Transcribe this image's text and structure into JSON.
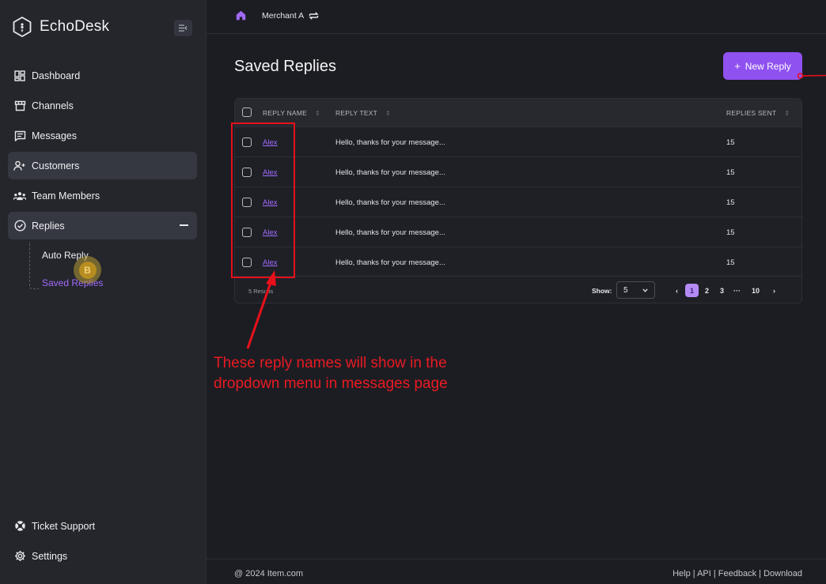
{
  "sidebar": {
    "brand": "EchoDesk",
    "items": [
      {
        "label": "Dashboard",
        "icon": "dashboard-icon"
      },
      {
        "label": "Channels",
        "icon": "store-icon"
      },
      {
        "label": "Messages",
        "icon": "message-icon"
      },
      {
        "label": "Customers",
        "icon": "customers-icon"
      },
      {
        "label": "Team Members",
        "icon": "team-icon"
      },
      {
        "label": "Replies",
        "icon": "check-circle-icon"
      }
    ],
    "sub_items": [
      {
        "label": "Auto Reply"
      },
      {
        "label": "Saved Replies"
      }
    ],
    "bottom_items": [
      {
        "label": "Ticket Support",
        "icon": "lifebuoy-icon"
      },
      {
        "label": "Settings",
        "icon": "gear-icon"
      }
    ],
    "cursor_badge": "B"
  },
  "topbar": {
    "merchant": "Merchant A"
  },
  "main": {
    "title": "Saved Replies",
    "new_reply_label": "New Reply",
    "table": {
      "headers": {
        "name": "REPLY NAME",
        "text": "REPLY TEXT",
        "sent": "REPLIES SENT"
      },
      "rows": [
        {
          "name": "Alex",
          "text": "Hello, thanks for your message...",
          "sent": "15"
        },
        {
          "name": "Alex",
          "text": "Hello, thanks for your message...",
          "sent": "15"
        },
        {
          "name": "Alex",
          "text": "Hello, thanks for your message...",
          "sent": "15"
        },
        {
          "name": "Alex",
          "text": "Hello, thanks for your message...",
          "sent": "15"
        },
        {
          "name": "Alex",
          "text": "Hello, thanks for your message...",
          "sent": "15"
        }
      ],
      "results": "5 Results",
      "show_label": "Show:",
      "show_value": "5",
      "pages": [
        "1",
        "2",
        "3",
        "···",
        "10"
      ],
      "current_page": "1"
    }
  },
  "annotation": {
    "text_line1": "These reply names will show in the",
    "text_line2": "dropdown menu in messages page",
    "color": "#e8101a"
  },
  "footer": {
    "copyright": "@ 2024 Item.com",
    "links": "Help | API | Feedback | Download"
  },
  "colors": {
    "accent": "#8f51f0",
    "link": "#a36bff",
    "background": "#1c1d23",
    "sidebar": "#24262c"
  }
}
